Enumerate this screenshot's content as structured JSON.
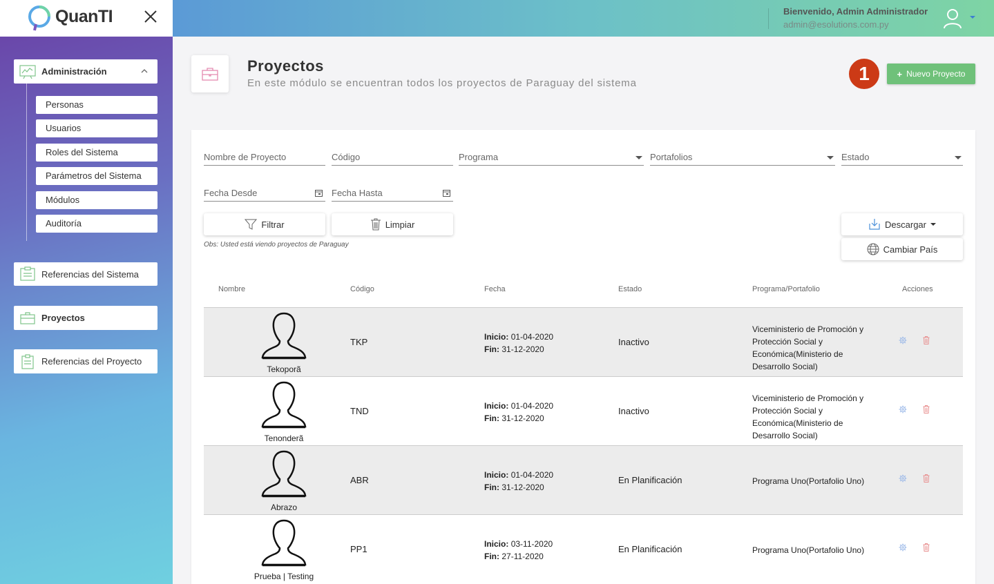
{
  "brand": {
    "logo_text": "QuanTI"
  },
  "sidebar": {
    "admin_label": "Administración",
    "sub_items": [
      "Personas",
      "Usuarios",
      "Roles del Sistema",
      "Parámetros del Sistema",
      "Módulos",
      "Auditoría"
    ],
    "refs_sistema": "Referencias del Sistema",
    "proyectos": "Proyectos",
    "refs_proyecto": "Referencias del Proyecto"
  },
  "header": {
    "welcome": "Bienvenido, Admin Administrador",
    "email": "admin@esolutions.com.py"
  },
  "page": {
    "title": "Proyectos",
    "subtitle": "En este módulo se encuentran todos los proyectos de Paraguay del sistema",
    "step_badge": "1",
    "new_button": "Nuevo Proyecto"
  },
  "filters": {
    "nombre": "Nombre de Proyecto",
    "codigo": "Código",
    "programa": "Programa",
    "portafolios": "Portafolios",
    "estado": "Estado",
    "fecha_desde": "Fecha Desde",
    "fecha_hasta": "Fecha Hasta",
    "filtrar": "Filtrar",
    "limpiar": "Limpiar",
    "descargar": "Descargar",
    "cambiar_pais": "Cambiar País",
    "obs": "Obs: Usted está viendo proyectos de Paraguay"
  },
  "table": {
    "headers": [
      "Nombre",
      "Código",
      "Fecha",
      "Estado",
      "Programa/Portafolio",
      "Acciones"
    ],
    "inicio_label": "Inicio:",
    "fin_label": "Fin:",
    "rows": [
      {
        "name": "Tekoporã",
        "code": "TKP",
        "inicio": "01-04-2020",
        "fin": "31-12-2020",
        "state": "Inactivo",
        "program": "Viceministerio de Promoción y Protección Social y Económica(Ministerio de Desarrollo Social)"
      },
      {
        "name": "Tenonderã",
        "code": "TND",
        "inicio": "01-04-2020",
        "fin": "31-12-2020",
        "state": "Inactivo",
        "program": "Viceministerio de Promoción y Protección Social y Económica(Ministerio de Desarrollo Social)"
      },
      {
        "name": "Abrazo",
        "code": "ABR",
        "inicio": "01-04-2020",
        "fin": "31-12-2020",
        "state": "En Planificación",
        "program": "Programa Uno(Portafolio Uno)"
      },
      {
        "name": "Prueba | Testing",
        "code": "PP1",
        "inicio": "03-11-2020",
        "fin": "27-11-2020",
        "state": "En Planificación",
        "program": "Programa Uno(Portafolio Uno)"
      }
    ]
  },
  "colors": {
    "accent_green": "#6fc17a",
    "badge_red": "#cc3a16",
    "gear_blue": "#9ab8e8",
    "trash_red": "#e89090"
  }
}
